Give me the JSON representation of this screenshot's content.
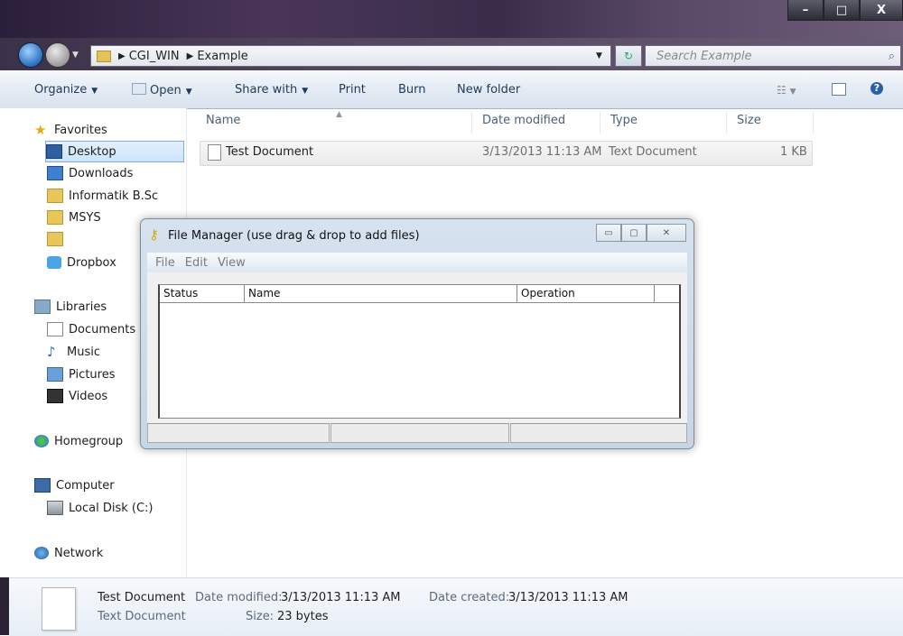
{
  "window": {
    "caption_buttons": [
      "–",
      "□",
      "X"
    ]
  },
  "address": {
    "crumbs": [
      "CGI_WIN",
      "Example"
    ],
    "search_placeholder": "Search Example"
  },
  "toolbar": {
    "organize": "Organize",
    "open": "Open",
    "share_with": "Share with",
    "print": "Print",
    "burn": "Burn",
    "new_folder": "New folder"
  },
  "nav": {
    "favorites": "Favorites",
    "desktop": "Desktop",
    "downloads": "Downloads",
    "informatik": "Informatik B.Sc",
    "msys": "MSYS",
    "unnamed_folder": "",
    "dropbox": "Dropbox",
    "libraries": "Libraries",
    "documents": "Documents",
    "music": "Music",
    "pictures": "Pictures",
    "videos": "Videos",
    "homegroup": "Homegroup",
    "computer": "Computer",
    "local_disk": "Local Disk (C:)",
    "network": "Network"
  },
  "columns": {
    "name": "Name",
    "date_modified": "Date modified",
    "type": "Type",
    "size": "Size"
  },
  "files": [
    {
      "name": "Test Document",
      "date_modified": "3/13/2013 11:13 AM",
      "type": "Text Document",
      "size": "1 KB"
    }
  ],
  "dialog": {
    "title": "File Manager (use drag & drop to add files)",
    "menu": [
      "File",
      "Edit",
      "View"
    ],
    "columns": [
      "Status",
      "Name",
      "Operation"
    ]
  },
  "details": {
    "name": "Test Document",
    "type": "Text Document",
    "date_modified_label": "Date modified:",
    "date_modified": "3/13/2013 11:13 AM",
    "date_created_label": "Date created:",
    "date_created": "3/13/2013 11:13 AM",
    "size_label": "Size:",
    "size": "23 bytes"
  }
}
